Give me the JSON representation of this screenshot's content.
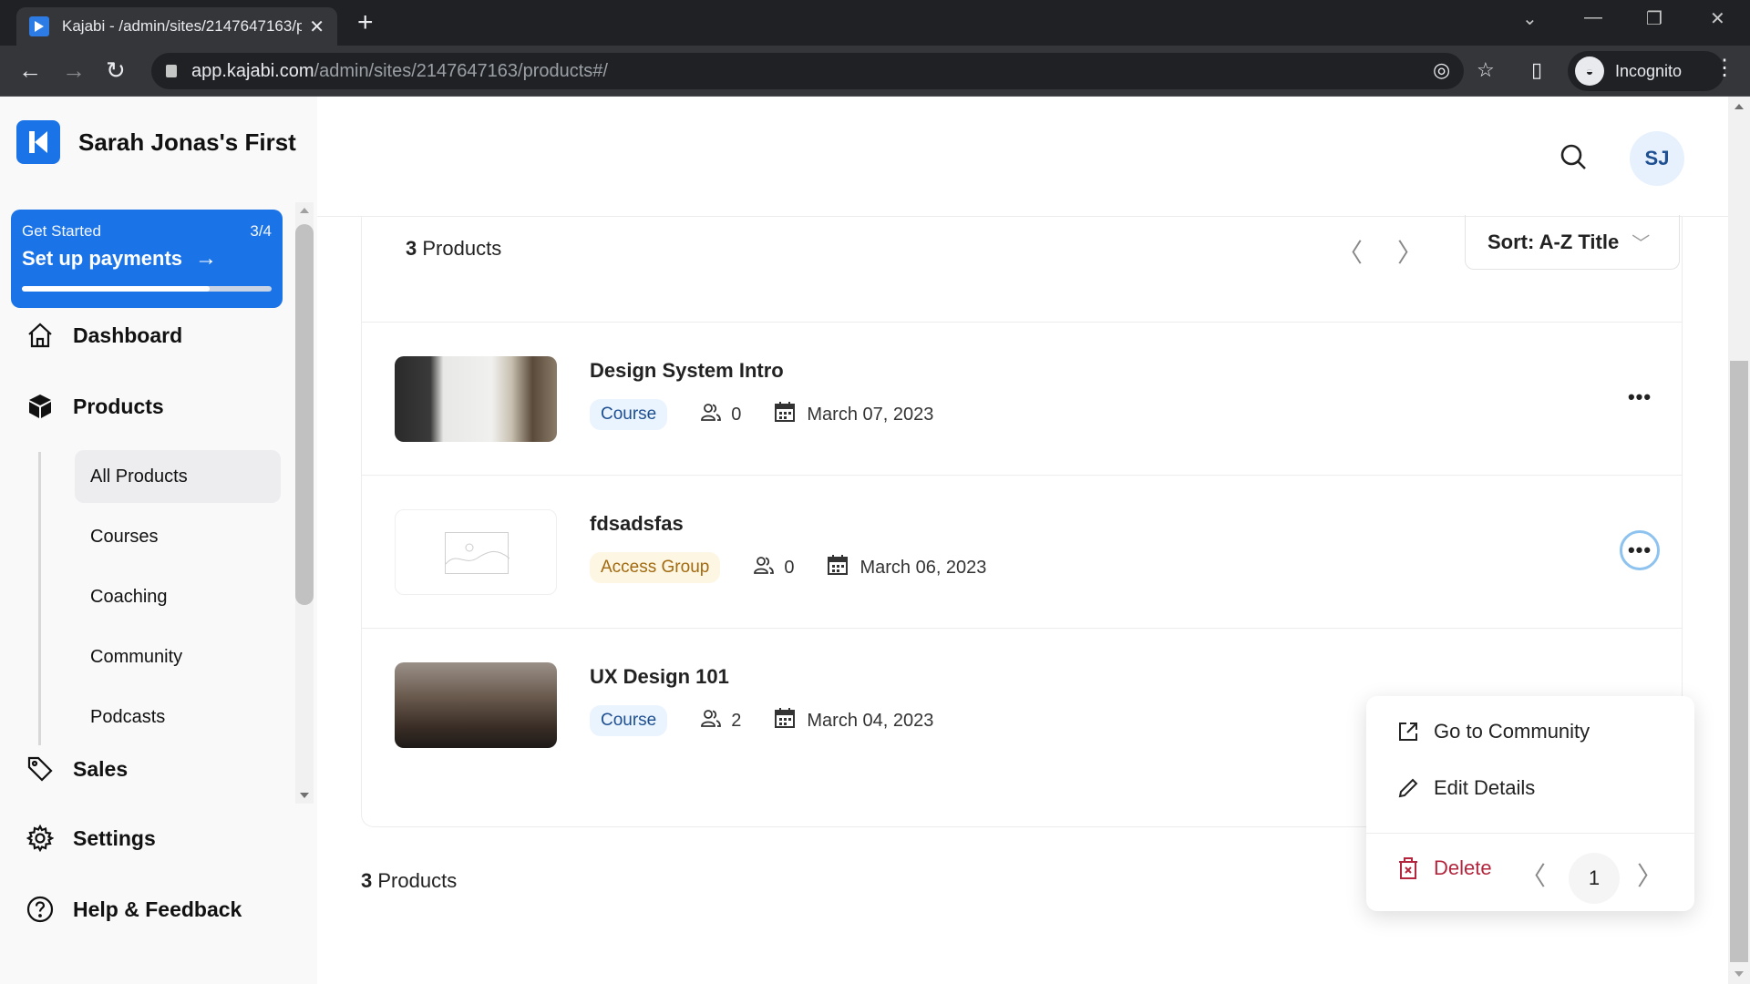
{
  "browser": {
    "tab_title": "Kajabi - /admin/sites/2147647163/products#/",
    "new_tab": "+",
    "url_host": "app.kajabi.com",
    "url_path": "/admin/sites/2147647163/products#/",
    "profile_label": "Incognito"
  },
  "sidebar": {
    "site_name": "Sarah Jonas's First",
    "get_started": {
      "label": "Get Started",
      "progress_text": "3/4",
      "title": "Set up payments",
      "progress_fraction": 0.75
    },
    "nav": [
      {
        "label": "Dashboard",
        "icon": "home-icon"
      },
      {
        "label": "Products",
        "icon": "box-icon"
      },
      {
        "label": "Sales",
        "icon": "tag-icon"
      },
      {
        "label": "Settings",
        "icon": "gear-icon"
      },
      {
        "label": "Help & Feedback",
        "icon": "help-icon"
      }
    ],
    "products_sub": [
      {
        "label": "All Products",
        "active": true
      },
      {
        "label": "Courses"
      },
      {
        "label": "Coaching"
      },
      {
        "label": "Community"
      },
      {
        "label": "Podcasts"
      }
    ]
  },
  "header": {
    "avatar_initials": "SJ"
  },
  "products": {
    "count_num": "3",
    "count_label": "Products",
    "sort_label": "Sort: A-Z Title",
    "items": [
      {
        "name": "Design System Intro",
        "type": "Course",
        "members": "0",
        "date": "March 07, 2023"
      },
      {
        "name": "fdsadsfas",
        "type": "Access Group",
        "members": "0",
        "date": "March 06, 2023"
      },
      {
        "name": "UX Design 101",
        "type": "Course",
        "members": "2",
        "date": "March 04, 2023"
      }
    ],
    "menu": {
      "go_community": "Go to Community",
      "edit_details": "Edit Details",
      "delete": "Delete"
    },
    "footer_count_num": "3",
    "footer_count_label": "Products",
    "current_page": "1"
  },
  "colors": {
    "brand": "#1b73e8",
    "danger": "#b3263d",
    "course_badge_text": "#1d4f91",
    "access_badge_text": "#a16a10"
  }
}
